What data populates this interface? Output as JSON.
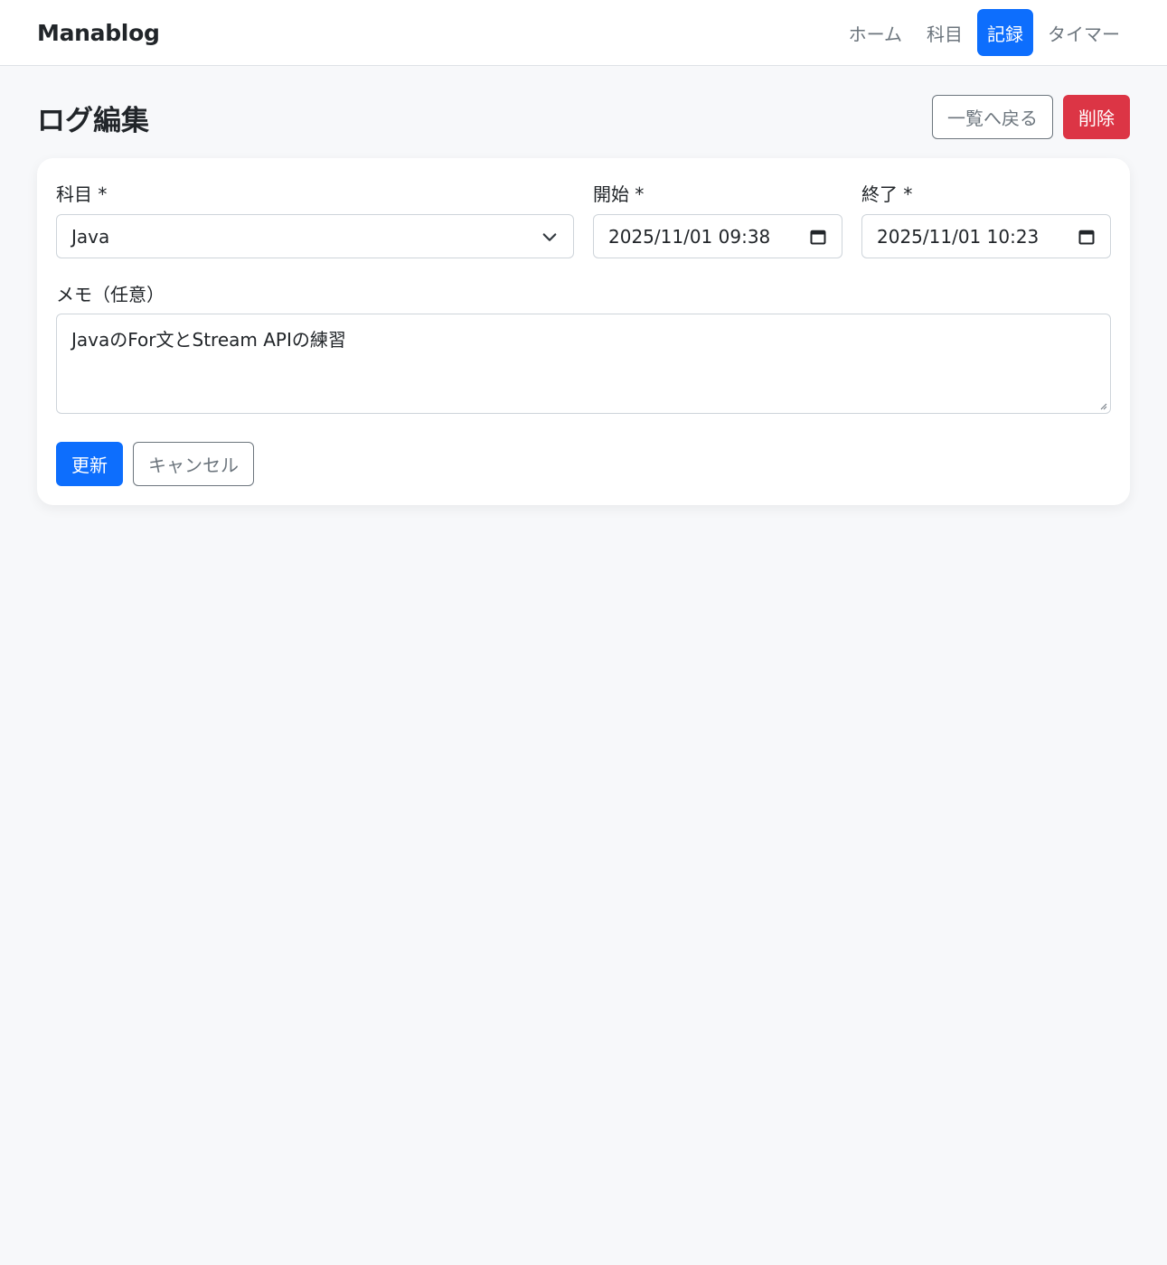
{
  "navbar": {
    "brand": "Manablog",
    "items": [
      {
        "label": "ホーム",
        "active": false
      },
      {
        "label": "科目",
        "active": false
      },
      {
        "label": "記録",
        "active": true
      },
      {
        "label": "タイマー",
        "active": false
      }
    ]
  },
  "page": {
    "title": "ログ編集",
    "back_label": "一覧へ戻る",
    "delete_label": "削除"
  },
  "form": {
    "subject": {
      "label": "科目 *",
      "value": "Java"
    },
    "start": {
      "label": "開始 *",
      "value": "2025/11/01 09:38"
    },
    "end": {
      "label": "終了 *",
      "value": "2025/11/01 10:23"
    },
    "memo": {
      "label": "メモ（任意）",
      "value": "JavaのFor文とStream APIの練習"
    },
    "update_label": "更新",
    "cancel_label": "キャンセル"
  },
  "colors": {
    "primary": "#0d6efd",
    "danger": "#dc3545",
    "secondary": "#6c757d",
    "background": "#f7f8fa"
  },
  "icons": {
    "select": "chevron-down-icon",
    "date": "calendar-icon"
  }
}
